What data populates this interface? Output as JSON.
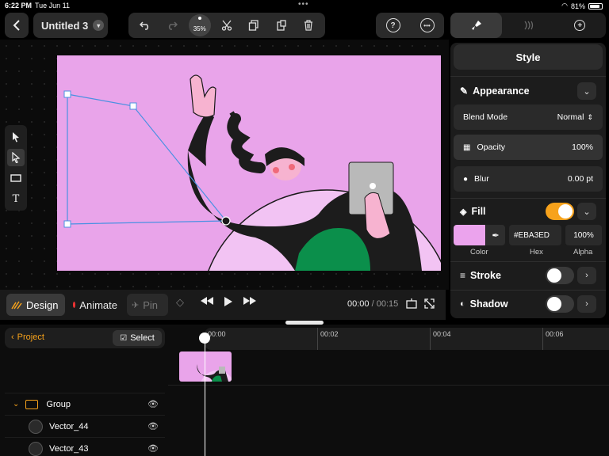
{
  "status": {
    "time": "6:22 PM",
    "date": "Tue Jun 11",
    "battery": "81%"
  },
  "toolbar": {
    "title": "Untitled 3",
    "zoom": "35%"
  },
  "inspector": {
    "style_title": "Style",
    "appearance": {
      "header": "Appearance",
      "blend_mode_label": "Blend Mode",
      "blend_mode_value": "Normal",
      "opacity_label": "Opacity",
      "opacity_value": "100%",
      "blur_label": "Blur",
      "blur_value": "0.00 pt"
    },
    "fill": {
      "header": "Fill",
      "enabled": true,
      "color": "#EBA3ED",
      "hex": "#EBA3ED",
      "alpha": "100%",
      "color_label": "Color",
      "hex_label": "Hex",
      "alpha_label": "Alpha"
    },
    "stroke": {
      "header": "Stroke",
      "enabled": false
    },
    "shadow": {
      "header": "Shadow",
      "enabled": false
    }
  },
  "modes": {
    "design": "Design",
    "animate": "Animate",
    "pin": "Pin"
  },
  "playback": {
    "current": "00:00",
    "total": "/ 00:15"
  },
  "layers": {
    "project_label": "Project",
    "select_label": "Select",
    "items": [
      {
        "name": "Group",
        "type": "group"
      },
      {
        "name": "Vector_44",
        "type": "vector"
      },
      {
        "name": "Vector_43",
        "type": "vector"
      }
    ]
  },
  "timeline": {
    "ticks": [
      "00:00",
      "00:02",
      "00:04",
      "00:06"
    ]
  },
  "colors": {
    "accent": "#F7A21B",
    "artboard": "#E9A4EA",
    "selection": "#4A90E2"
  }
}
